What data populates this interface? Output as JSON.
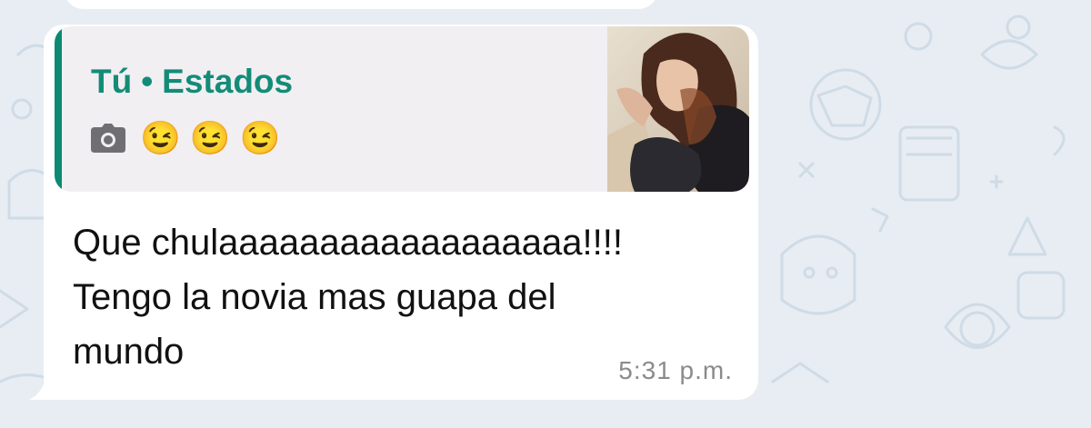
{
  "quoted_status": {
    "author": "Tú",
    "separator": "•",
    "source": "Estados",
    "media_icon": "camera-icon",
    "emojis": [
      "😉",
      "😉",
      "😉"
    ],
    "thumbnail": "photo-thumbnail"
  },
  "message": {
    "lines": [
      "Que chulaaaaaaaaaaaaaaaaaa!!!!",
      "Tengo la novia mas guapa del",
      "mundo"
    ],
    "time": "5:31 p.m."
  },
  "colors": {
    "chat_background": "#e7edf2",
    "bubble": "#ffffff",
    "quote_background": "#f1eff2",
    "quote_accent": "#0a8a73",
    "quote_author": "#138c77",
    "timestamp": "#8b8b8d"
  }
}
